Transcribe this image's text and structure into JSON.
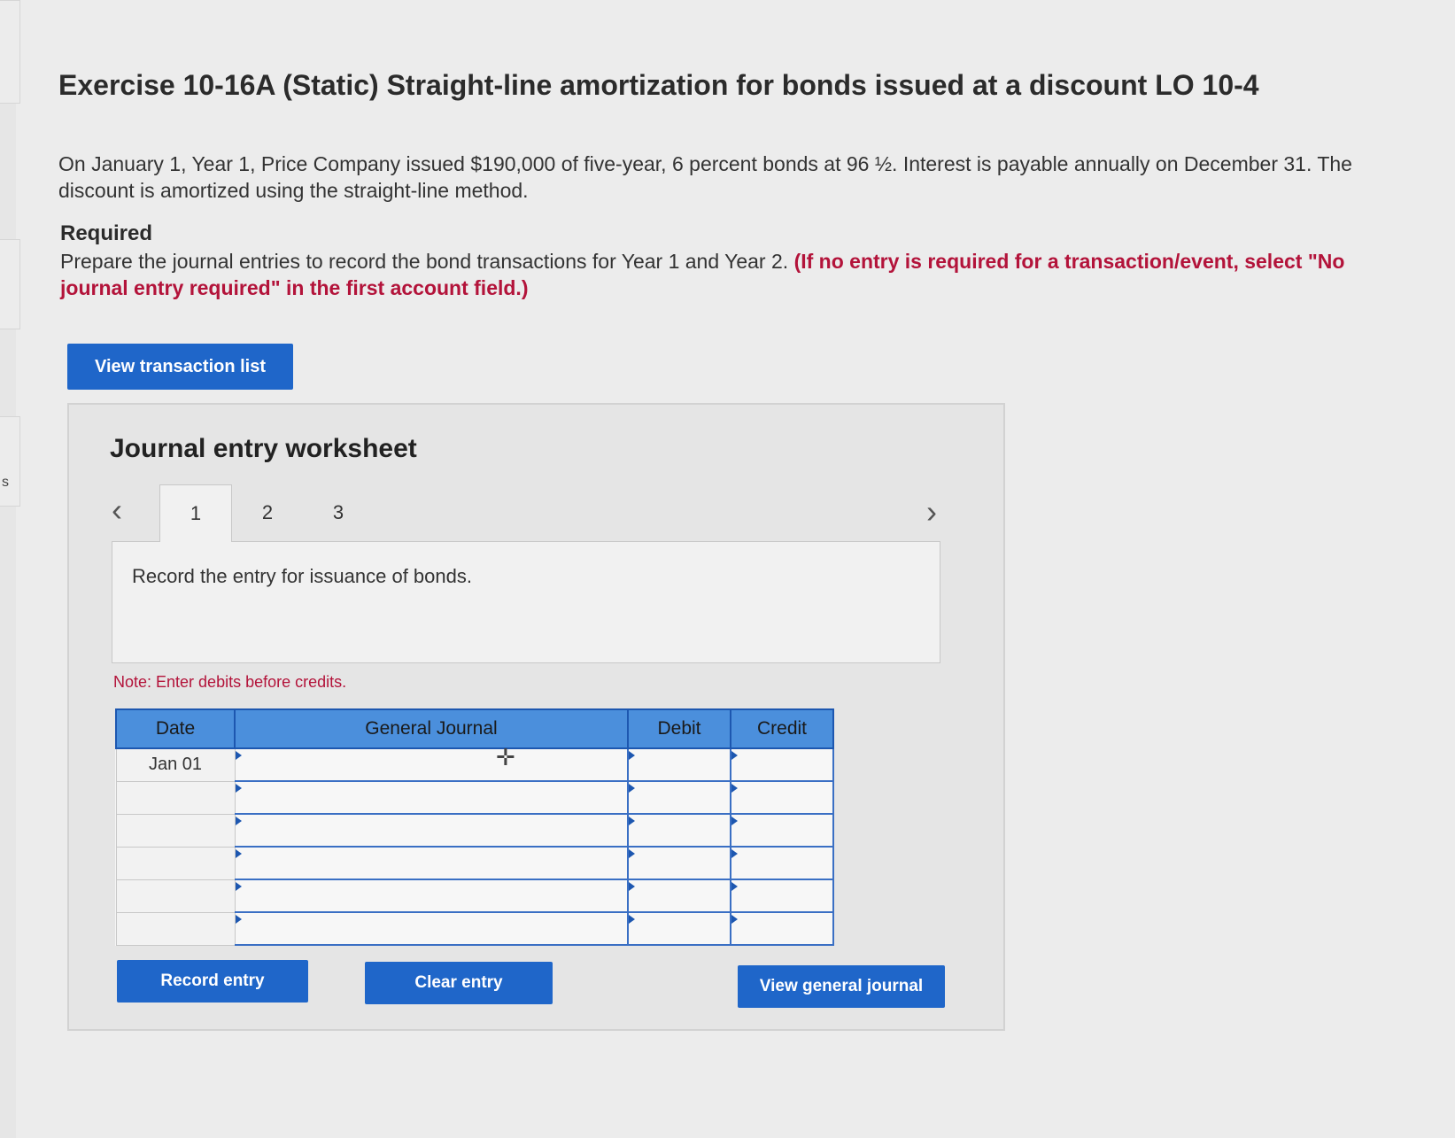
{
  "title": "Exercise 10-16A (Static) Straight-line amortization for bonds issued at a discount LO 10-4",
  "intro": "On January 1, Year 1, Price Company issued $190,000 of five-year, 6 percent bonds at 96 ½. Interest is payable annually on December 31. The discount is amortized using the straight-line method.",
  "required": {
    "heading": "Required",
    "text": "Prepare the journal entries to record the bond transactions for Year 1 and Year 2.",
    "instruction": "(If no entry is required for a transaction/event, select \"No journal entry required\" in the first account field.)"
  },
  "edge_letter": "s",
  "buttons": {
    "view_transaction_list": "View transaction list",
    "record_entry": "Record entry",
    "clear_entry": "Clear entry",
    "view_general_journal": "View general journal"
  },
  "worksheet": {
    "title": "Journal entry worksheet",
    "tabs": [
      "1",
      "2",
      "3"
    ],
    "active_tab": "1",
    "prompt": "Record the entry for issuance of bonds.",
    "note": "Note: Enter debits before credits."
  },
  "journal": {
    "headers": {
      "date": "Date",
      "general_journal": "General Journal",
      "debit": "Debit",
      "credit": "Credit"
    },
    "rows": [
      {
        "date": "Jan 01",
        "account": "",
        "debit": "",
        "credit": ""
      },
      {
        "date": "",
        "account": "",
        "debit": "",
        "credit": ""
      },
      {
        "date": "",
        "account": "",
        "debit": "",
        "credit": ""
      },
      {
        "date": "",
        "account": "",
        "debit": "",
        "credit": ""
      },
      {
        "date": "",
        "account": "",
        "debit": "",
        "credit": ""
      },
      {
        "date": "",
        "account": "",
        "debit": "",
        "credit": ""
      }
    ]
  },
  "colors": {
    "button_blue": "#1f66c9",
    "header_blue": "#4b8fdc",
    "instruction_red": "#b3133a"
  }
}
